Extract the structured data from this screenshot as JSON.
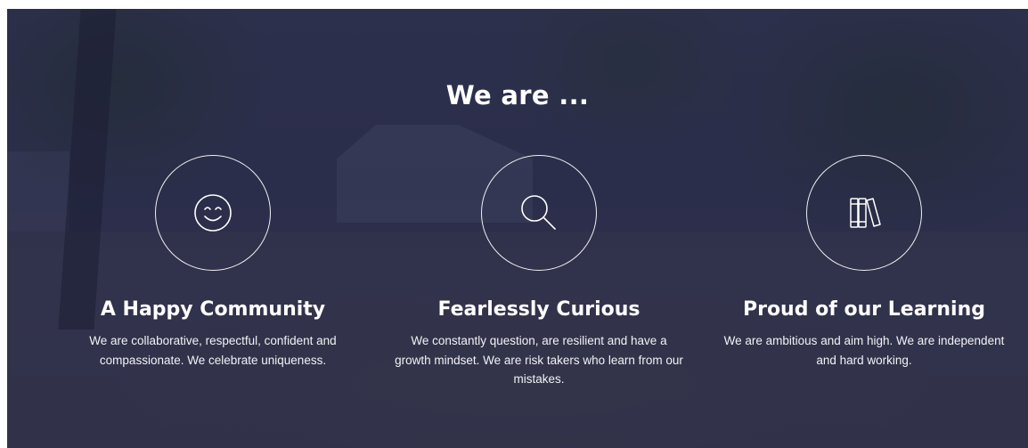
{
  "heading": "We are ...",
  "values": [
    {
      "icon": "smiley-face-icon",
      "title": "A Happy Community",
      "text": "We are collaborative, respectful, confident and compassionate. We celebrate uniqueness."
    },
    {
      "icon": "magnifying-glass-icon",
      "title": "Fearlessly Curious",
      "text": "We constantly question, are resilient and have a growth mindset. We are risk takers who learn from our mistakes."
    },
    {
      "icon": "books-icon",
      "title": "Proud of our Learning",
      "text": "We are ambitious and aim high. We are independent and hard working."
    }
  ],
  "colors": {
    "overlay": "#222446",
    "text": "#ffffff"
  }
}
